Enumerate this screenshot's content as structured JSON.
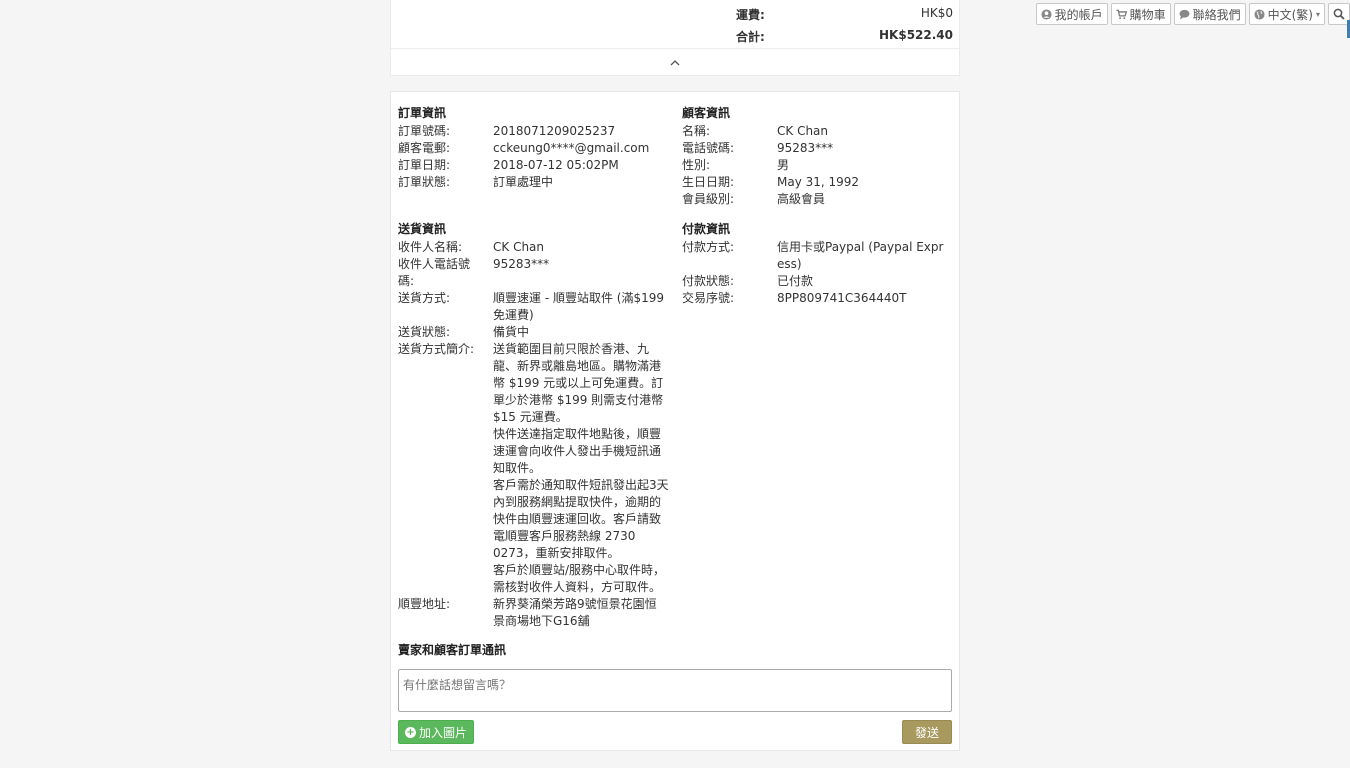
{
  "nav": {
    "account": "我的帳戶",
    "cart": "購物車",
    "contact": "聯絡我們",
    "language": "中文(繁)"
  },
  "summary": {
    "shipping_label": "運費:",
    "shipping_value": "HK$0",
    "total_label": "合計:",
    "total_value": "HK$522.40"
  },
  "order_info": {
    "title": "訂單資訊",
    "rows": [
      {
        "k": "訂單號碼:",
        "v": "2018071209025237"
      },
      {
        "k": "顧客電郵:",
        "v": "cckeung0****@gmail.com"
      },
      {
        "k": "訂單日期:",
        "v": "2018-07-12 05:02PM"
      },
      {
        "k": "訂單狀態:",
        "v": "訂單處理中"
      }
    ]
  },
  "customer_info": {
    "title": "顧客資訊",
    "rows": [
      {
        "k": "名稱:",
        "v": "CK Chan"
      },
      {
        "k": "電話號碼:",
        "v": "95283***"
      },
      {
        "k": "性別:",
        "v": "男"
      },
      {
        "k": "生日日期:",
        "v": "May 31, 1992"
      },
      {
        "k": "會員級別:",
        "v": "高級會員"
      }
    ]
  },
  "delivery_info": {
    "title": "送貨資訊",
    "recipient_name_k": "收件人名稱:",
    "recipient_name_v": "CK Chan",
    "recipient_phone_k": "收件人電話號碼:",
    "recipient_phone_v": "95283***",
    "method_k": "送貨方式:",
    "method_v": "順豐速運 - 順豐站取件 (滿$199免運費)",
    "status_k": "送貨狀態:",
    "status_v": "備貨中",
    "intro_k": "送貨方式簡介:",
    "intro_p1": "送貨範圍目前只限於香港、九龍、新界或離島地區。購物滿港幣 $199 元或以上可免運費。訂單少於港幣 $199 則需支付港幣 $15 元運費。",
    "intro_p2": "快件送達指定取件地點後，順豐速運會向收件人發出手機短訊通知取件。",
    "intro_p3": "客戶需於通知取件短訊發出起3天內到服務網點提取快件，逾期的快件由順豐速運回收。客戶請致電順豐客戶服務熱線 2730 0273，重新安排取件。",
    "intro_p4": "客戶於順豐站/服務中心取件時，需核對收件人資料，方可取件。",
    "address_k": "順豐地址:",
    "address_v": "新界葵涌榮芳路9號恒景花園恒景商場地下G16舖"
  },
  "payment_info": {
    "title": "付款資訊",
    "method_k": "付款方式:",
    "method_v": "信用卡或Paypal (Paypal Express)",
    "status_k": "付款狀態:",
    "status_v": "已付款",
    "txn_k": "交易序號:",
    "txn_v": "8PP809741C364440T"
  },
  "messages": {
    "title": "賣家和顧客訂單通訊",
    "placeholder": "有什麼話想留言嗎？",
    "add_image": "加入圖片",
    "send": "發送"
  },
  "colors": {
    "green": "#5cb85c",
    "send": "#a89a5f"
  }
}
